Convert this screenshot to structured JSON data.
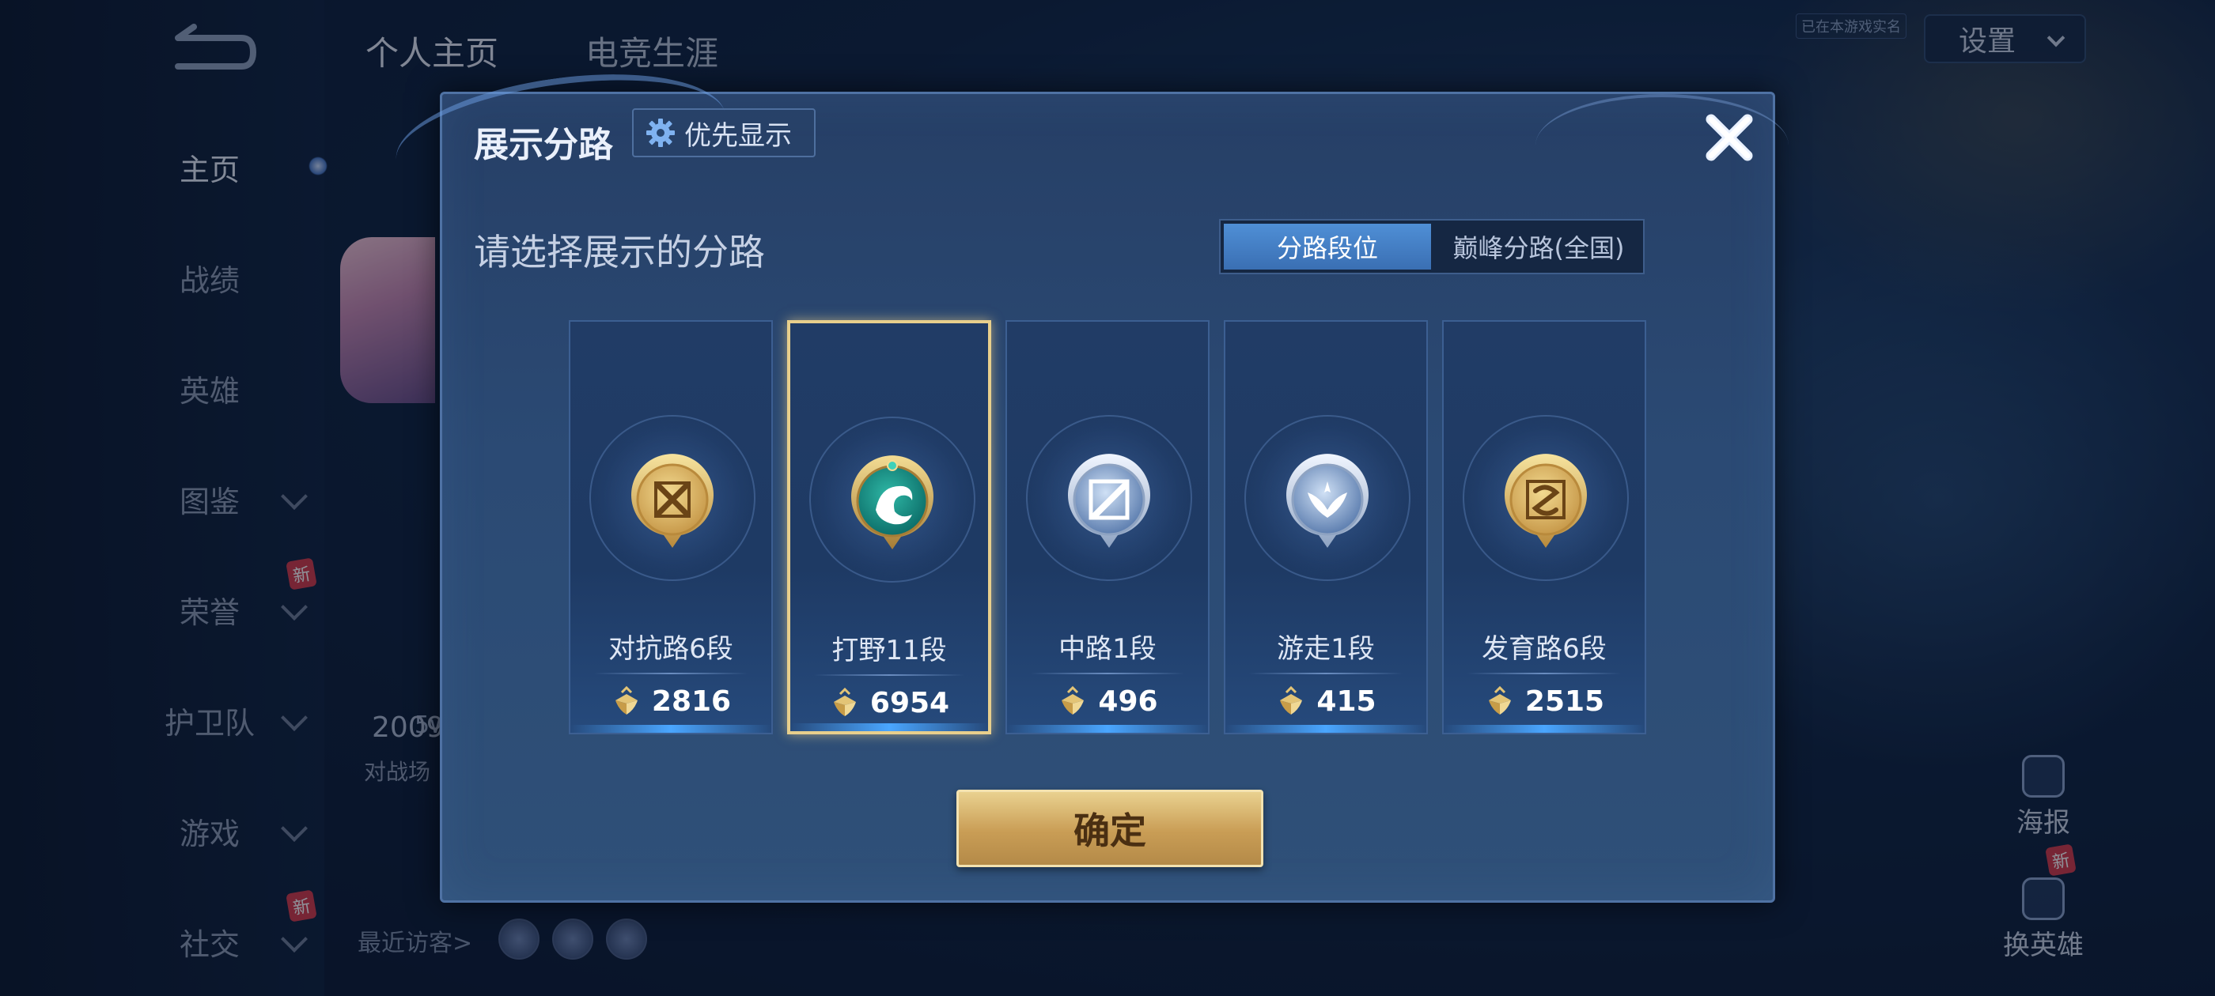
{
  "background": {
    "top_tabs": [
      "个人主页",
      "电竞生涯"
    ],
    "settings_label": "设置",
    "top_notice": "已在本游戏实名",
    "nav_items": [
      {
        "label": "主页",
        "active": true,
        "has_chevron": false
      },
      {
        "label": "战绩",
        "active": false,
        "has_chevron": false
      },
      {
        "label": "英雄",
        "active": false,
        "has_chevron": false
      },
      {
        "label": "图鉴",
        "active": false,
        "has_chevron": true
      },
      {
        "label": "荣誉",
        "active": false,
        "has_chevron": true,
        "badge": "新"
      },
      {
        "label": "护卫队",
        "active": false,
        "has_chevron": true
      },
      {
        "label": "游戏",
        "active": false,
        "has_chevron": true
      },
      {
        "label": "社交",
        "active": false,
        "has_chevron": true,
        "badge": "新"
      }
    ],
    "stat_value": "2009",
    "stat_label": "对战场",
    "misc_text": "5w",
    "recent_visitors": "最近访客>",
    "right_actions": [
      {
        "label": "海报",
        "icon": "poster-icon"
      },
      {
        "label": "换英雄",
        "icon": "swap-hero-icon",
        "badge": "新"
      }
    ]
  },
  "modal": {
    "title": "展示分路",
    "priority_button": "优先显示",
    "subtitle": "请选择展示的分路",
    "segments": [
      {
        "label": "分路段位",
        "active": true
      },
      {
        "label": "巅峰分路(全国)",
        "active": false
      }
    ],
    "lanes": [
      {
        "name": "对抗路6段",
        "score": "2816",
        "emblem": "clash-lane-emblem",
        "tone": "gold",
        "selected": false
      },
      {
        "name": "打野11段",
        "score": "6954",
        "emblem": "jungle-emblem",
        "tone": "jade",
        "selected": true
      },
      {
        "name": "中路1段",
        "score": "496",
        "emblem": "mid-lane-emblem",
        "tone": "silver",
        "selected": false
      },
      {
        "name": "游走1段",
        "score": "415",
        "emblem": "roam-emblem",
        "tone": "silver",
        "selected": false
      },
      {
        "name": "发育路6段",
        "score": "2515",
        "emblem": "farm-lane-emblem",
        "tone": "gold",
        "selected": false
      }
    ],
    "confirm_label": "确定"
  },
  "colors": {
    "gold": "#d9b45c",
    "selected_border": "#e8cf8c",
    "accent_blue": "#4f8fd6"
  }
}
